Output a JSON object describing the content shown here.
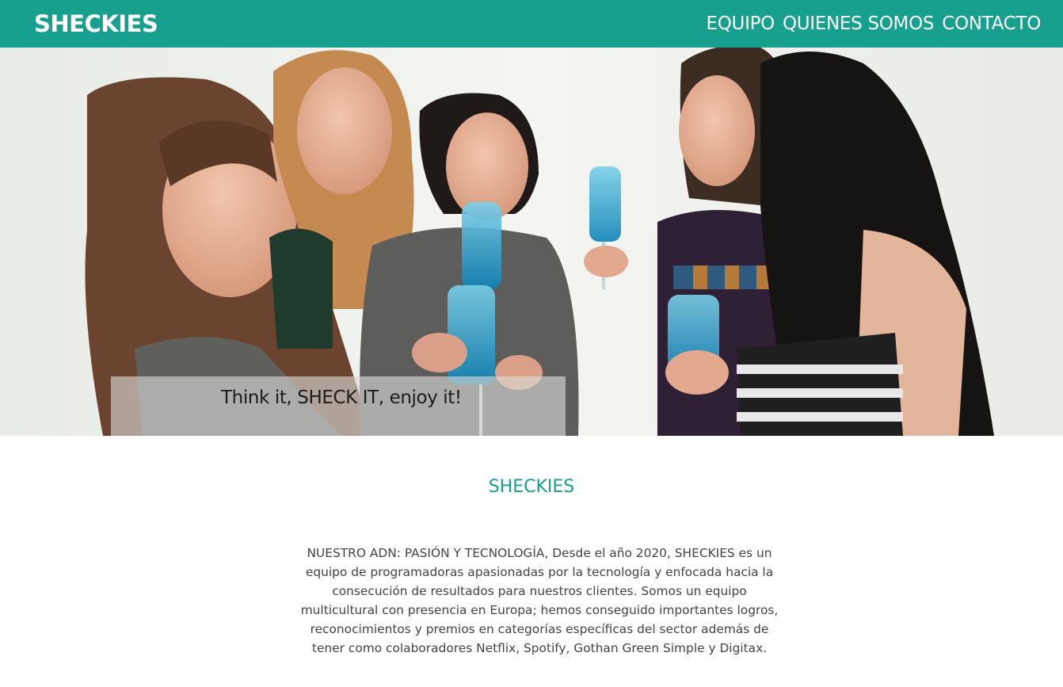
{
  "header": {
    "brand": "SHECKIES",
    "nav": [
      {
        "label": "EQUIPO"
      },
      {
        "label": "QUIENES SOMOS"
      },
      {
        "label": "CONTACTO"
      }
    ]
  },
  "hero": {
    "image_description_icon": "group-photo",
    "tagline": "Think it, SHECK IT, enjoy it!"
  },
  "about": {
    "title": "SHECKIES",
    "text": "NUESTRO ADN: PASIÓN Y TECNOLOGÍA, Desde el año 2020, SHECKIES es un equipo de programadoras apasionadas por la tecnología y enfocada hacia la consecución de resultados para nuestros clientes. Somos un equipo multicultural con presencia en Europa; hemos conseguido importantes logros, reconocimientos y premios en categorías específicas del sector además de tener como colaboradores Netflix, Spotify, Gothan Green Simple y Digitax."
  },
  "colors": {
    "accent": "#17a08d",
    "text": "#444444"
  }
}
